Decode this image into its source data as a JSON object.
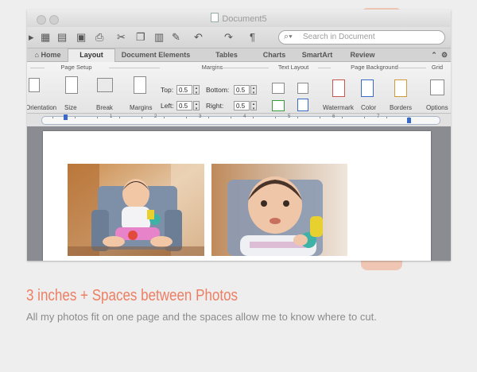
{
  "window": {
    "title": "Document5",
    "search_placeholder": "Search in Document"
  },
  "toolbar_icons": [
    "new-doc-icon",
    "save-icon",
    "print-icon",
    "cut-icon",
    "copy-icon",
    "paste-icon",
    "format-painter-icon",
    "undo-icon",
    "redo-icon",
    "pilcrow-icon"
  ],
  "tabs": [
    {
      "label": "Home"
    },
    {
      "label": "Layout"
    },
    {
      "label": "Document Elements"
    },
    {
      "label": "Tables"
    },
    {
      "label": "Charts"
    },
    {
      "label": "SmartArt"
    },
    {
      "label": "Review"
    }
  ],
  "ribbon": {
    "groups": {
      "page_setup": "Page Setup",
      "margins": "Margins",
      "text_layout": "Text Layout",
      "page_background": "Page Background",
      "grid": "Grid"
    },
    "buttons": {
      "orientation": "Orientation",
      "size": "Size",
      "break": "Break",
      "margins": "Margins",
      "watermark": "Watermark",
      "color": "Color",
      "borders": "Borders",
      "options": "Options"
    },
    "margin_fields": {
      "top_label": "Top:",
      "top_value": "0.5",
      "bottom_label": "Bottom:",
      "bottom_value": "0.5",
      "left_label": "Left:",
      "left_value": "0.5",
      "right_label": "Right:",
      "right_value": "0.5"
    }
  },
  "ruler": {
    "numbers": [
      "1",
      "2",
      "3",
      "4",
      "5",
      "6",
      "7"
    ]
  },
  "caption": {
    "title": "3 inches + Spaces between Photos",
    "text": "All my photos fit on one page and the spaces allow me to know where to cut."
  },
  "colors": {
    "accent": "#ec7f63",
    "caption_text": "#8b8b8b",
    "background": "#efeeee"
  }
}
